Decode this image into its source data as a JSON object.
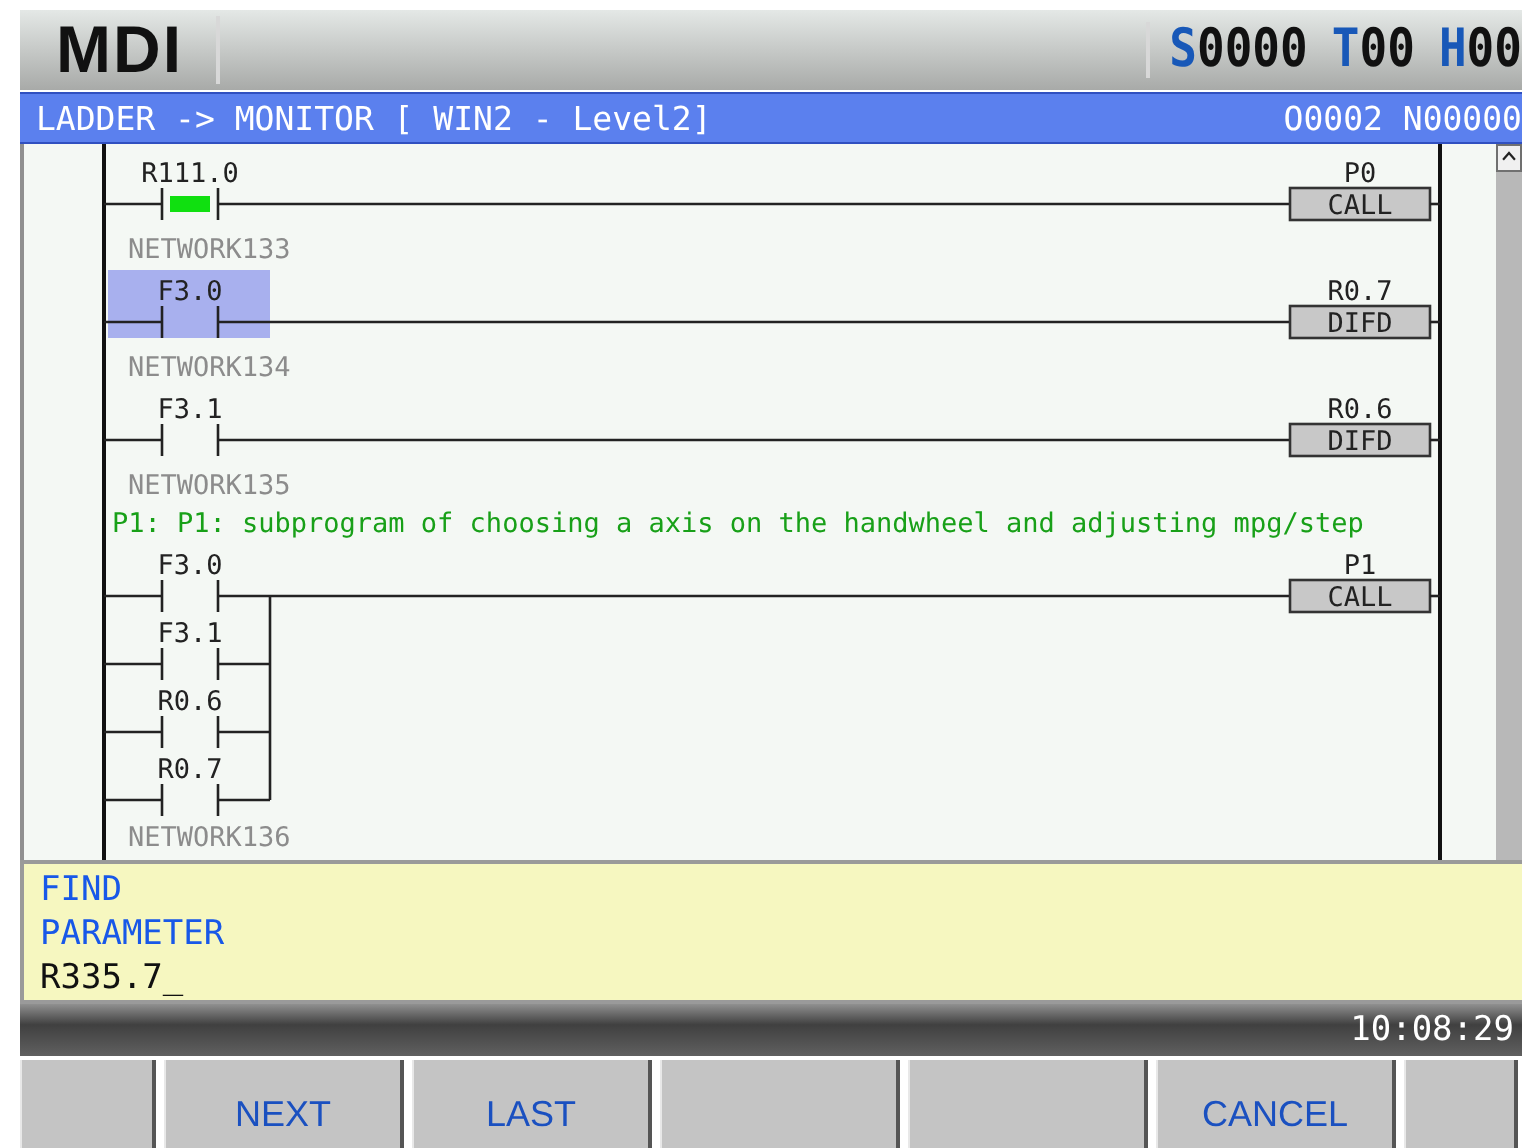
{
  "header": {
    "mode": "MDI",
    "status": [
      {
        "letter": "S",
        "value": "0000"
      },
      {
        "letter": "T",
        "value": "00"
      },
      {
        "letter": "H",
        "value": "00"
      }
    ]
  },
  "title_bar": {
    "title": "LADDER -> MONITOR [ WIN2 - Level2]",
    "program": "O0002 N00000"
  },
  "ladder": {
    "rungs": [
      {
        "contacts": [
          {
            "label": "R111.0",
            "energized": true,
            "selected": false
          }
        ],
        "output": {
          "operand": "P0",
          "instruction": "CALL"
        }
      },
      {
        "network": "NETWORK133",
        "contacts": [
          {
            "label": "F3.0",
            "energized": false,
            "selected": true
          }
        ],
        "output": {
          "operand": "R0.7",
          "instruction": "DIFD"
        }
      },
      {
        "network": "NETWORK134",
        "contacts": [
          {
            "label": "F3.1",
            "energized": false,
            "selected": false
          }
        ],
        "output": {
          "operand": "R0.6",
          "instruction": "DIFD"
        }
      },
      {
        "network": "NETWORK135",
        "comment": "P1: P1: subprogram of choosing a axis on the handwheel  and adjusting mpg/step",
        "contacts": [
          {
            "label": "F3.0",
            "energized": false,
            "selected": false
          },
          {
            "label": "F3.1",
            "energized": false,
            "selected": false
          },
          {
            "label": "R0.6",
            "energized": false,
            "selected": false
          },
          {
            "label": "R0.7",
            "energized": false,
            "selected": false
          }
        ],
        "output": {
          "operand": "P1",
          "instruction": "CALL"
        }
      },
      {
        "network": "NETWORK136"
      }
    ]
  },
  "find_panel": {
    "title": "FIND",
    "label": "PARAMETER",
    "value": "R335.7_"
  },
  "status_bar": {
    "time": "10:08:29"
  },
  "softkeys": [
    {
      "kind": "blank"
    },
    {
      "kind": "label",
      "label": "NEXT"
    },
    {
      "kind": "label",
      "label": "LAST"
    },
    {
      "kind": "blank"
    },
    {
      "kind": "blank"
    },
    {
      "kind": "label",
      "label": "CANCEL"
    },
    {
      "kind": "blank"
    }
  ]
}
